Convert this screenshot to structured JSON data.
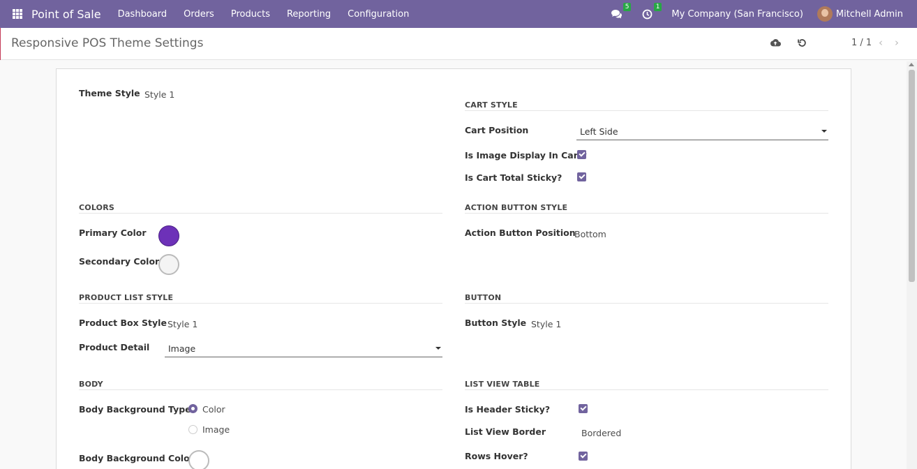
{
  "navbar": {
    "app_title": "Point of Sale",
    "menu": [
      "Dashboard",
      "Orders",
      "Products",
      "Reporting",
      "Configuration"
    ],
    "messages_count": "5",
    "activities_count": "1",
    "company": "My Company (San Francisco)",
    "user": "Mitchell Admin",
    "accent_color": "#71639e"
  },
  "control_panel": {
    "title": "Responsive POS Theme Settings",
    "pager": "1 / 1"
  },
  "form": {
    "theme_style": {
      "label": "Theme Style",
      "value": "Style 1"
    },
    "cart_style": {
      "title": "CART STYLE",
      "cart_position": {
        "label": "Cart Position",
        "value": "Left Side"
      },
      "image_display": {
        "label": "Is Image Display In Cart?",
        "checked": true
      },
      "total_sticky": {
        "label": "Is Cart Total Sticky?",
        "checked": true
      }
    },
    "colors": {
      "title": "COLORS",
      "primary": {
        "label": "Primary Color",
        "color": "#6d31b8"
      },
      "secondary": {
        "label": "Secondary Color",
        "color": "#f4f4f4"
      }
    },
    "action_button_style": {
      "title": "ACTION BUTTON STYLE",
      "position": {
        "label": "Action Button Position",
        "value": "Bottom"
      }
    },
    "product_list_style": {
      "title": "PRODUCT LIST STYLE",
      "box_style": {
        "label": "Product Box Style",
        "value": "Style 1"
      },
      "detail": {
        "label": "Product Detail",
        "value": "Image"
      }
    },
    "button": {
      "title": "BUTTON",
      "style": {
        "label": "Button Style",
        "value": "Style 1"
      }
    },
    "body": {
      "title": "BODY",
      "background_type": {
        "label": "Body Background Type",
        "options": [
          "Color",
          "Image"
        ],
        "selected": "Color"
      },
      "background_color": {
        "label": "Body Background Color",
        "color": "#ffffff"
      }
    },
    "list_view_table": {
      "title": "LIST VIEW TABLE",
      "header_sticky": {
        "label": "Is Header Sticky?",
        "checked": true
      },
      "border": {
        "label": "List View Border",
        "value": "Bordered"
      },
      "rows_hover": {
        "label": "Rows Hover?",
        "checked": true
      }
    }
  }
}
